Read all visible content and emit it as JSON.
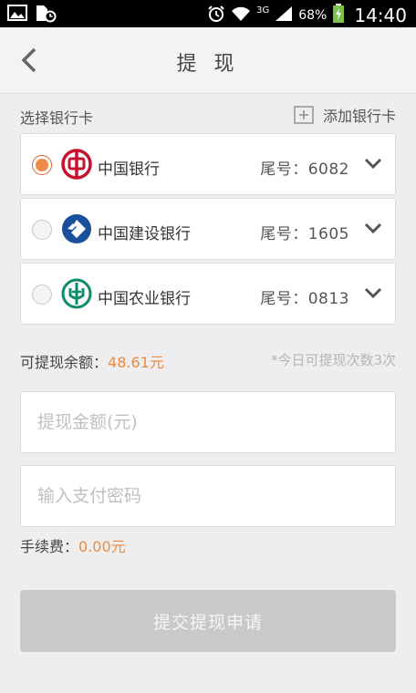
{
  "status_bar": {
    "network": "3G",
    "battery": "68%",
    "time": "14:40",
    "icons": [
      "image-icon",
      "file-sync-icon",
      "alarm-icon",
      "wifi-icon",
      "signal-icon",
      "battery-charging-icon"
    ]
  },
  "header": {
    "title": "提 现",
    "back_icon": "chevron-left-icon"
  },
  "card_section": {
    "label": "选择银行卡",
    "add_label": "添加银行卡",
    "cards": [
      {
        "name": "中国银行",
        "tail": "尾号：6082",
        "selected": true,
        "logo": "boc-logo-icon",
        "color": "#c8102e"
      },
      {
        "name": "中国建设银行",
        "tail": "尾号：1605",
        "selected": false,
        "logo": "ccb-logo-icon",
        "color": "#1a4f9c"
      },
      {
        "name": "中国农业银行",
        "tail": "尾号：0813",
        "selected": false,
        "logo": "abc-logo-icon",
        "color": "#0e8c6e"
      }
    ]
  },
  "balance": {
    "label": "可提现余额：",
    "amount": "48.61元"
  },
  "limit_note": "*今日可提现次数3次",
  "amount_field": {
    "placeholder": "提现金额(元)",
    "value": ""
  },
  "password_field": {
    "placeholder": "输入支付密码",
    "value": ""
  },
  "fee": {
    "label": "手续费：",
    "amount": "0.00元"
  },
  "submit_label": "提交提现申请",
  "colors": {
    "accent": "#f08a3c",
    "button_disabled": "#c9c9cb",
    "background": "#eeeef0"
  }
}
